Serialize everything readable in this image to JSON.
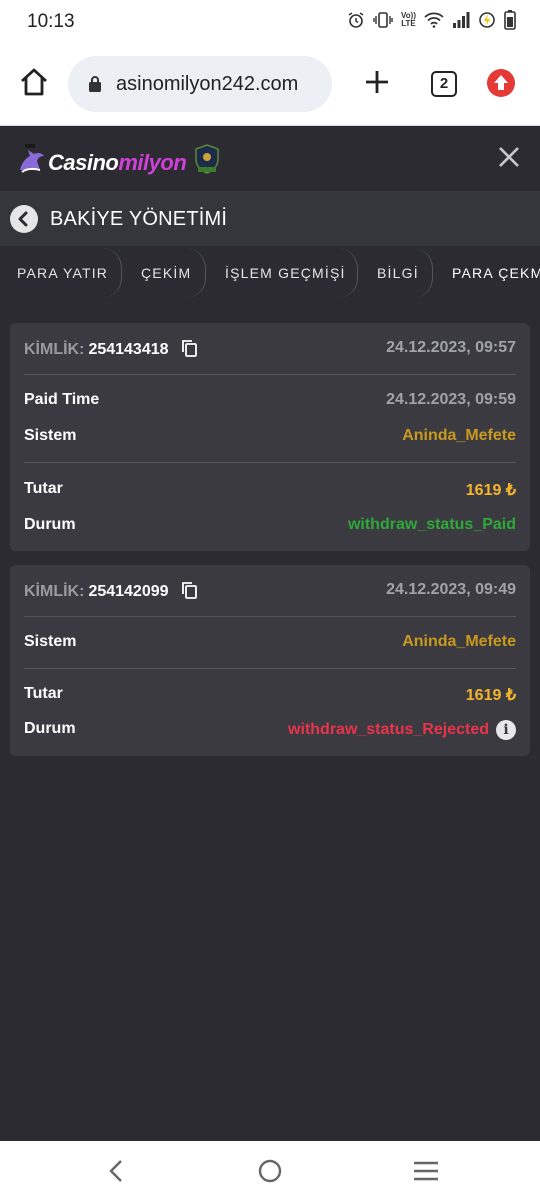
{
  "status_bar": {
    "time": "10:13",
    "icons": [
      "alarm-icon",
      "vibrate-icon",
      "volte-icon",
      "wifi-icon",
      "signal-icon",
      "data-saver-icon",
      "battery-icon"
    ],
    "volte_text": "Vo))\nLTE"
  },
  "browser": {
    "url": "asinomilyon242.com",
    "tab_count": "2"
  },
  "site": {
    "brand_prefix": "Casino",
    "brand_suffix": "milyon",
    "accent_color": "#d040d8"
  },
  "page": {
    "title": "BAKİYE YÖNETİMİ"
  },
  "tabs": [
    {
      "label": "PARA YATIR"
    },
    {
      "label": "ÇEKİM"
    },
    {
      "label": "İŞLEM GEÇMİŞİ"
    },
    {
      "label": "BİLGİ"
    },
    {
      "label": "PARA ÇEKM"
    }
  ],
  "transactions": [
    {
      "id_label": "KİMLİK:",
      "id": "254143418",
      "date": "24.12.2023, 09:57",
      "paid_time_label": "Paid Time",
      "paid_time": "24.12.2023, 09:59",
      "system_label": "Sistem",
      "system": "Aninda_Mefete",
      "amount_label": "Tutar",
      "amount": "1619 ₺",
      "status_label": "Durum",
      "status": "withdraw_status_Paid"
    },
    {
      "id_label": "KİMLİK:",
      "id": "254142099",
      "date": "24.12.2023, 09:49",
      "system_label": "Sistem",
      "system": "Aninda_Mefete",
      "amount_label": "Tutar",
      "amount": "1619 ₺",
      "status_label": "Durum",
      "status": "withdraw_status_Rejected"
    }
  ],
  "colors": {
    "background": "#2b2b31",
    "card": "#3a3a40",
    "system_text": "#c99a1e",
    "amount_text": "#f4b52c",
    "status_paid": "#2fa83a",
    "status_rejected": "#e8334a"
  }
}
